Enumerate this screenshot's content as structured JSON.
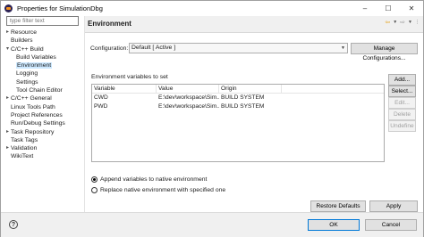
{
  "window": {
    "title": "Properties for SimulationDbg"
  },
  "filter": {
    "placeholder": "type filter text"
  },
  "tree": [
    {
      "label": "Resource",
      "expandable": true
    },
    {
      "label": "Builders",
      "expandable": false
    },
    {
      "label": "C/C++ Build",
      "expandable": true,
      "expanded": true
    },
    {
      "label": "Build Variables",
      "child": true
    },
    {
      "label": "Environment",
      "child": true,
      "selected": true
    },
    {
      "label": "Logging",
      "child": true
    },
    {
      "label": "Settings",
      "child": true
    },
    {
      "label": "Tool Chain Editor",
      "child": true
    },
    {
      "label": "C/C++ General",
      "expandable": true
    },
    {
      "label": "Linux Tools Path",
      "expandable": false
    },
    {
      "label": "Project References",
      "expandable": false
    },
    {
      "label": "Run/Debug Settings",
      "expandable": false
    },
    {
      "label": "Task Repository",
      "expandable": true
    },
    {
      "label": "Task Tags",
      "expandable": false
    },
    {
      "label": "Validation",
      "expandable": true
    },
    {
      "label": "WikiText",
      "expandable": false
    }
  ],
  "page": {
    "title": "Environment"
  },
  "config": {
    "label": "Configuration:",
    "value": "Default  [ Active ]",
    "manage_button": "Manage Configurations..."
  },
  "env": {
    "group_label": "Environment variables to set",
    "columns": [
      "Variable",
      "Value",
      "Origin"
    ],
    "rows": [
      {
        "variable": "CWD",
        "value": "E:\\dev\\workspace\\Sim...",
        "origin": "BUILD SYSTEM"
      },
      {
        "variable": "PWD",
        "value": "E:\\dev\\workspace\\Sim...",
        "origin": "BUILD SYSTEM"
      }
    ],
    "buttons": {
      "add": "Add...",
      "select": "Select...",
      "edit": "Edit...",
      "delete": "Delete",
      "undefine": "Undefine"
    }
  },
  "radios": {
    "append": "Append variables to native environment",
    "replace": "Replace native environment with specified one",
    "selected": "append"
  },
  "buttons": {
    "restore": "Restore Defaults",
    "apply": "Apply",
    "ok": "OK",
    "cancel": "Cancel"
  },
  "icons": {
    "help": "?",
    "back": "⇦",
    "forward": "⇨",
    "minimize": "–",
    "maximize": "☐",
    "close": "✕"
  }
}
